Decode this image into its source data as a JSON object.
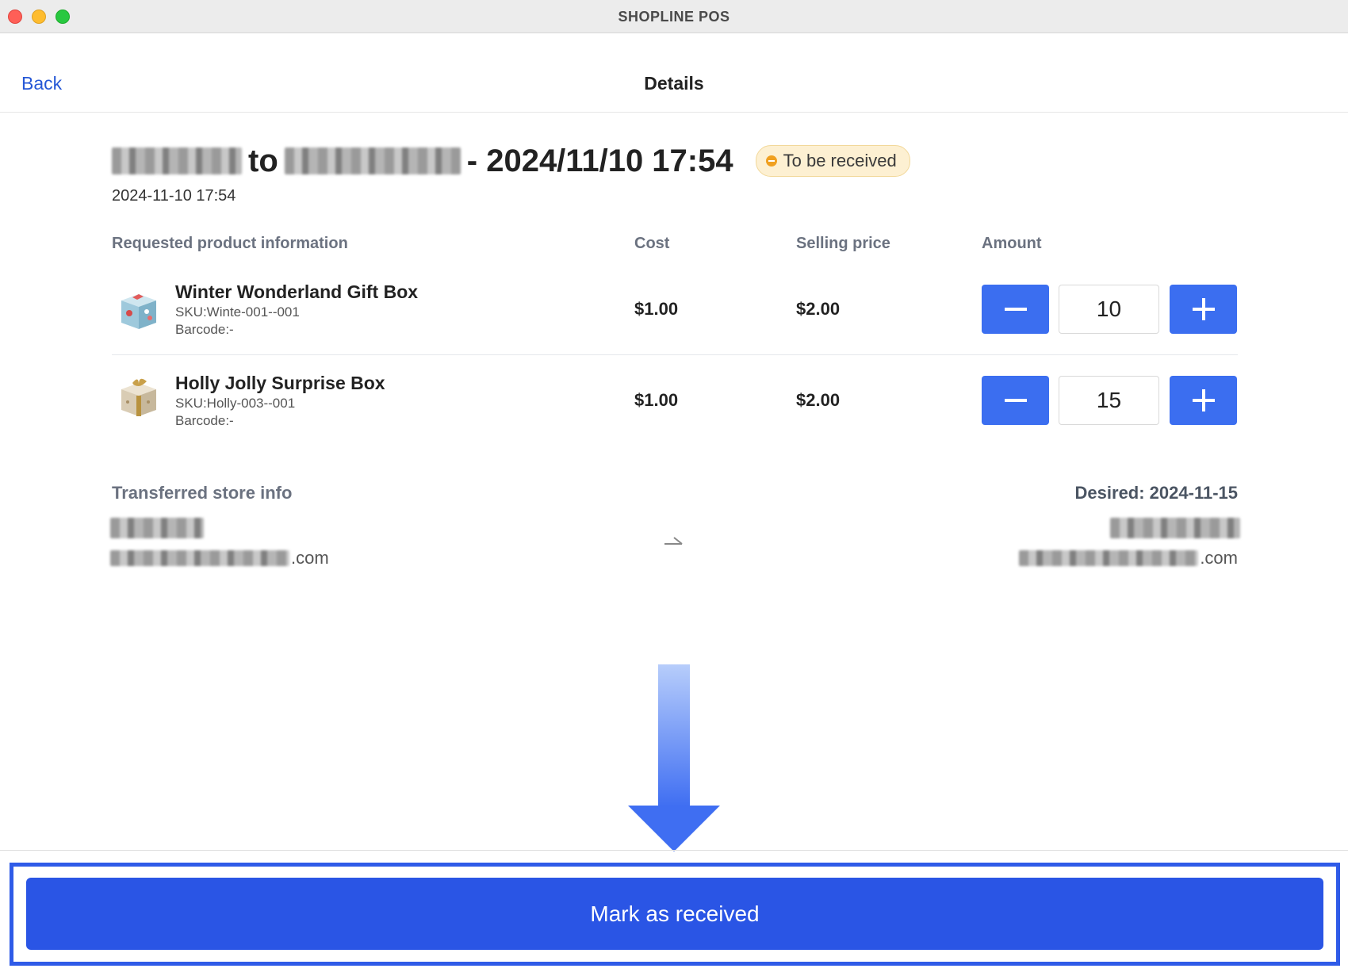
{
  "window": {
    "title": "SHOPLINE POS"
  },
  "header": {
    "back_label": "Back",
    "title": "Details"
  },
  "transfer": {
    "connector_word": "to",
    "heading_suffix": "- 2024/11/10 17:54",
    "status": "To be received",
    "created_date": "2024-11-10 17:54"
  },
  "table": {
    "columns": {
      "product": "Requested product information",
      "cost": "Cost",
      "selling_price": "Selling price",
      "amount": "Amount"
    },
    "rows": [
      {
        "name": "Winter Wonderland Gift Box",
        "sku": "SKU:Winte-001--001",
        "barcode": "Barcode:-",
        "cost": "$1.00",
        "selling_price": "$2.00",
        "quantity": "10"
      },
      {
        "name": "Holly Jolly Surprise Box",
        "sku": "SKU:Holly-003--001",
        "barcode": "Barcode:-",
        "cost": "$1.00",
        "selling_price": "$2.00",
        "quantity": "15"
      }
    ]
  },
  "store_info": {
    "label": "Transferred store info",
    "desired": "Desired: 2024-11-15",
    "from_email_suffix": ".com",
    "to_email_suffix": ".com"
  },
  "footer": {
    "primary_button": "Mark as received"
  },
  "colors": {
    "accent": "#2a55e5",
    "link": "#2557d6",
    "badge_bg": "#fdf0d2",
    "badge_dot": "#f0a020"
  },
  "icons": {
    "minus": "minus-icon",
    "plus": "plus-icon",
    "transfer_arrow": "arrow-right-icon",
    "annotation_arrow": "arrow-down-icon"
  }
}
